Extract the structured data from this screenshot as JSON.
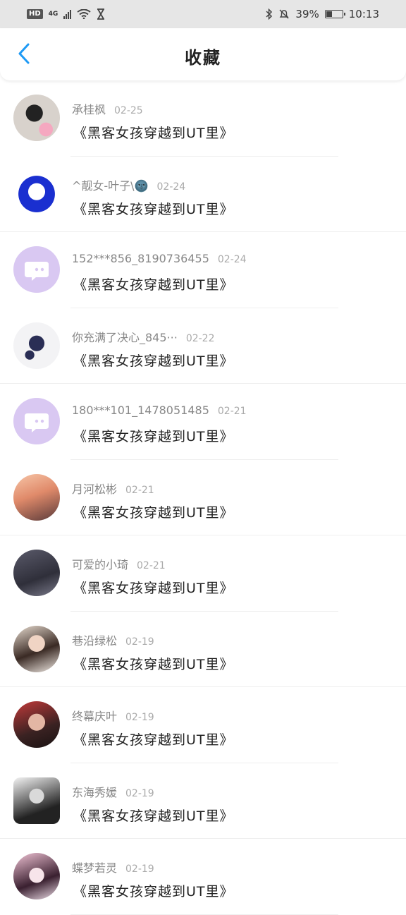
{
  "status_bar": {
    "hd": "HD",
    "network": "4G",
    "battery_percent": "39%",
    "battery_level": 0.39,
    "time": "10:13"
  },
  "nav": {
    "title": "收藏"
  },
  "favorites": [
    {
      "user": "承桂枫",
      "date": "02-25",
      "book": "《黑客女孩穿越到UT里》"
    },
    {
      "user": "^靓女-叶子\\🌚",
      "date": "02-24",
      "book": "《黑客女孩穿越到UT里》"
    },
    {
      "user": "152***856_8190736455",
      "date": "02-24",
      "book": "《黑客女孩穿越到UT里》"
    },
    {
      "user": "你充满了决心_845···",
      "date": "02-22",
      "book": "《黑客女孩穿越到UT里》"
    },
    {
      "user": "180***101_1478051485",
      "date": "02-21",
      "book": "《黑客女孩穿越到UT里》"
    },
    {
      "user": "月河松彬",
      "date": "02-21",
      "book": "《黑客女孩穿越到UT里》"
    },
    {
      "user": "可爱的小琦",
      "date": "02-21",
      "book": "《黑客女孩穿越到UT里》"
    },
    {
      "user": "巷沿绿松",
      "date": "02-19",
      "book": "《黑客女孩穿越到UT里》"
    },
    {
      "user": "终幕庆叶",
      "date": "02-19",
      "book": "《黑客女孩穿越到UT里》"
    },
    {
      "user": "东海秀媛",
      "date": "02-19",
      "book": "《黑客女孩穿越到UT里》"
    },
    {
      "user": "蝶梦若灵",
      "date": "02-19",
      "book": "《黑客女孩穿越到UT里》"
    }
  ],
  "colors": {
    "accent": "#1e9af5",
    "default_avatar": "#d9c8f2"
  }
}
